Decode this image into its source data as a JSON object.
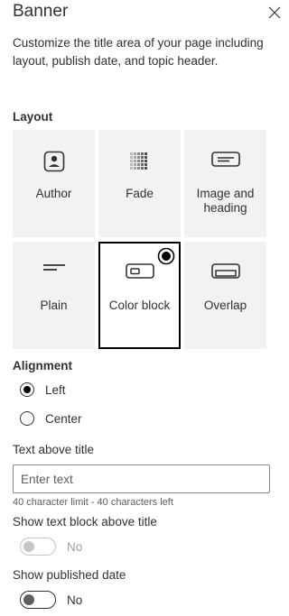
{
  "panel": {
    "title": "Banner",
    "description": "Customize the title area of your page including layout, publish date, and topic header."
  },
  "layout": {
    "label": "Layout",
    "options": [
      {
        "label": "Author",
        "icon": "author-icon",
        "selected": false
      },
      {
        "label": "Fade",
        "icon": "fade-icon",
        "selected": false
      },
      {
        "label": "Image and heading",
        "icon": "image-and-heading-icon",
        "selected": false
      },
      {
        "label": "Plain",
        "icon": "plain-icon",
        "selected": false
      },
      {
        "label": "Color block",
        "icon": "color-block-icon",
        "selected": true
      },
      {
        "label": "Overlap",
        "icon": "overlap-icon",
        "selected": false
      }
    ]
  },
  "alignment": {
    "label": "Alignment",
    "options": [
      {
        "label": "Left",
        "checked": true
      },
      {
        "label": "Center",
        "checked": false
      }
    ]
  },
  "text_above_title": {
    "label": "Text above title",
    "placeholder": "Enter text",
    "value": "",
    "hint": "40 character limit - 40 characters left"
  },
  "show_text_block": {
    "label": "Show text block above title",
    "state": "No",
    "disabled": true
  },
  "show_published_date": {
    "label": "Show published date",
    "state": "No",
    "disabled": false
  },
  "colors": {
    "text": "#323130",
    "tile_background": "#f3f2f1",
    "selected_border": "#000000",
    "disabled": "#c8c6c4"
  }
}
